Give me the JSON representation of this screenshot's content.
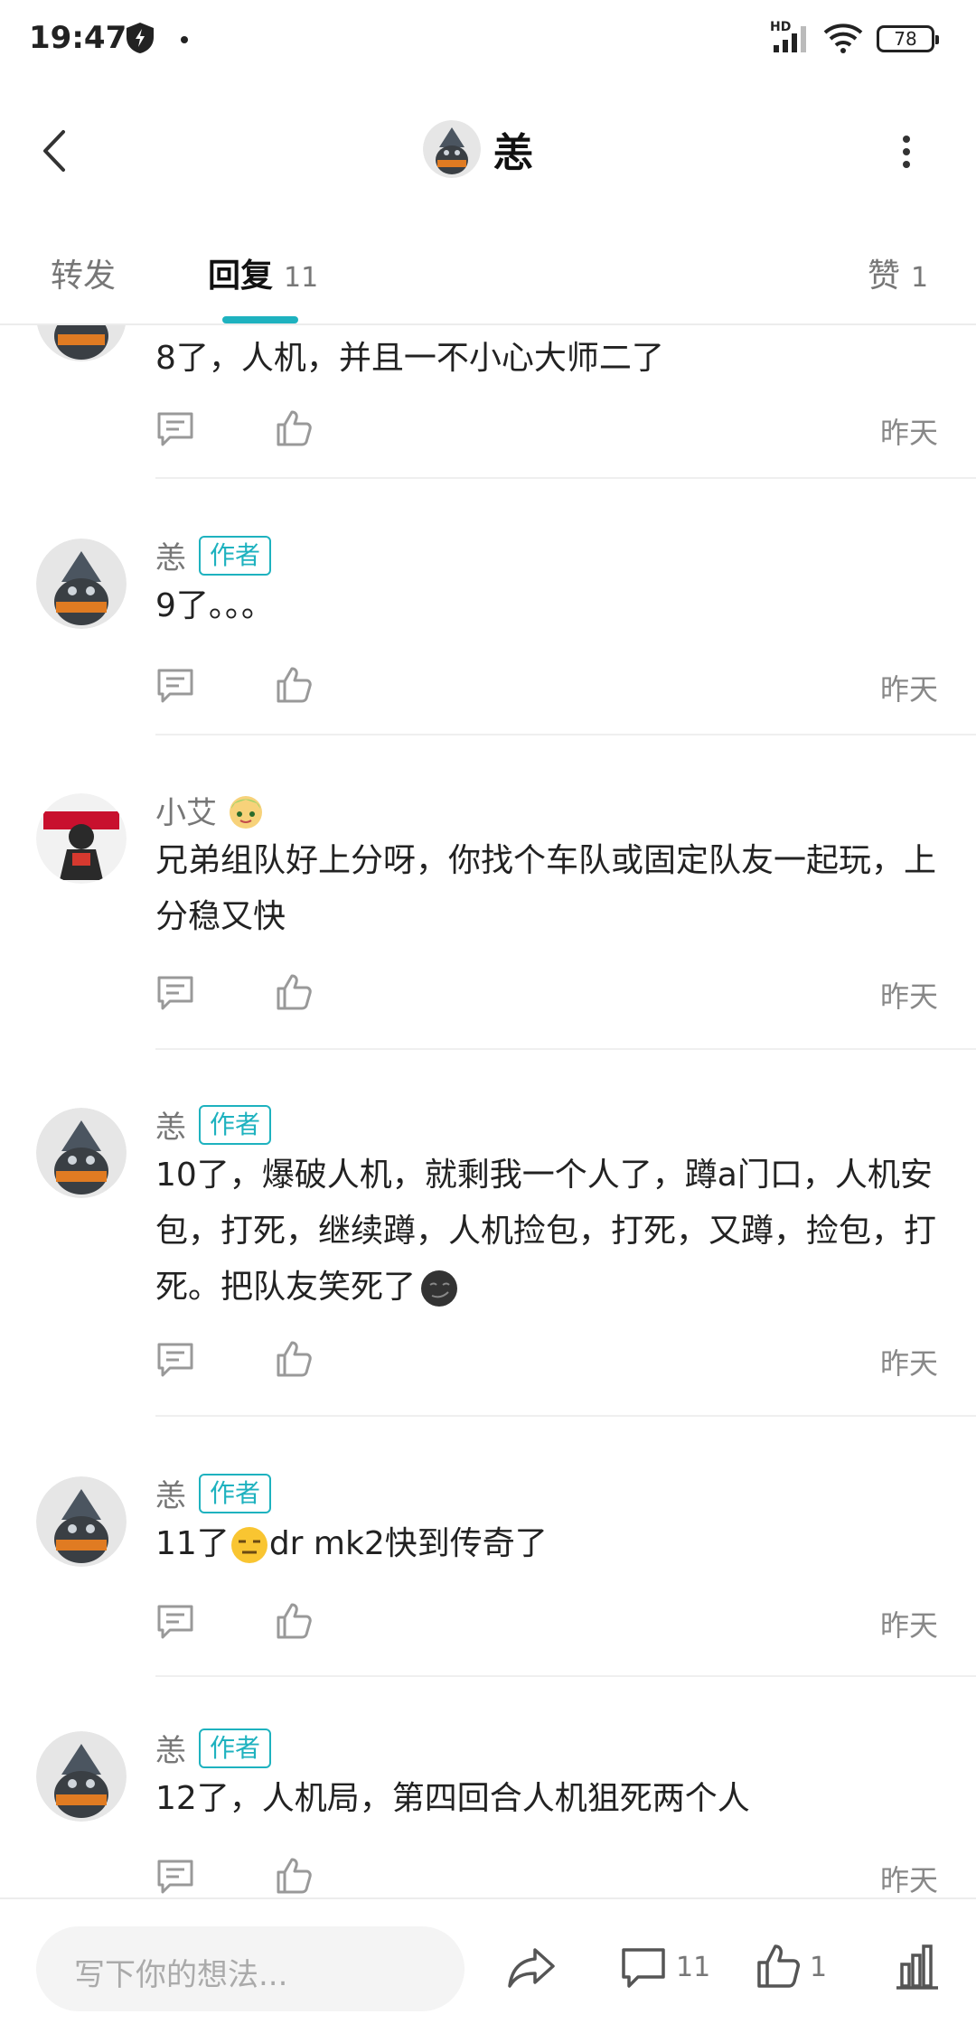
{
  "status": {
    "time": "19:47",
    "battery": "78",
    "network": "HD"
  },
  "header": {
    "title": "恙"
  },
  "tabs": [
    {
      "label": "转发",
      "count": ""
    },
    {
      "label": "回复",
      "count": "11"
    },
    {
      "label": "赞",
      "count": "1"
    }
  ],
  "comments": [
    {
      "name": "",
      "badge": "",
      "text": "8了，人机，并且一不小心大师二了",
      "time": "昨天"
    },
    {
      "name": "恙",
      "badge": "作者",
      "text": "9了。。。",
      "time": "昨天"
    },
    {
      "name": "小艾",
      "badge": "",
      "text": "兄弟组队好上分呀，你找个车队或固定队友一起玩，上分稳又快",
      "time": "昨天"
    },
    {
      "name": "恙",
      "badge": "作者",
      "text": "10了，爆破人机，就剩我一个人了，蹲a门口，人机安包，打死，继续蹲，人机捡包，打死，又蹲，捡包，打死。把队友笑死了",
      "time": "昨天"
    },
    {
      "name": "恙",
      "badge": "作者",
      "text_before": "11了",
      "text_after": "dr mk2快到传奇了",
      "time": "昨天"
    },
    {
      "name": "恙",
      "badge": "作者",
      "text": "12了，人机局，第四回合人机狙死两个人",
      "time": "昨天"
    }
  ],
  "bottom": {
    "placeholder": "写下你的想法...",
    "comment_count": "11",
    "like_count": "1"
  },
  "colors": {
    "accent": "#1eb2bf"
  }
}
